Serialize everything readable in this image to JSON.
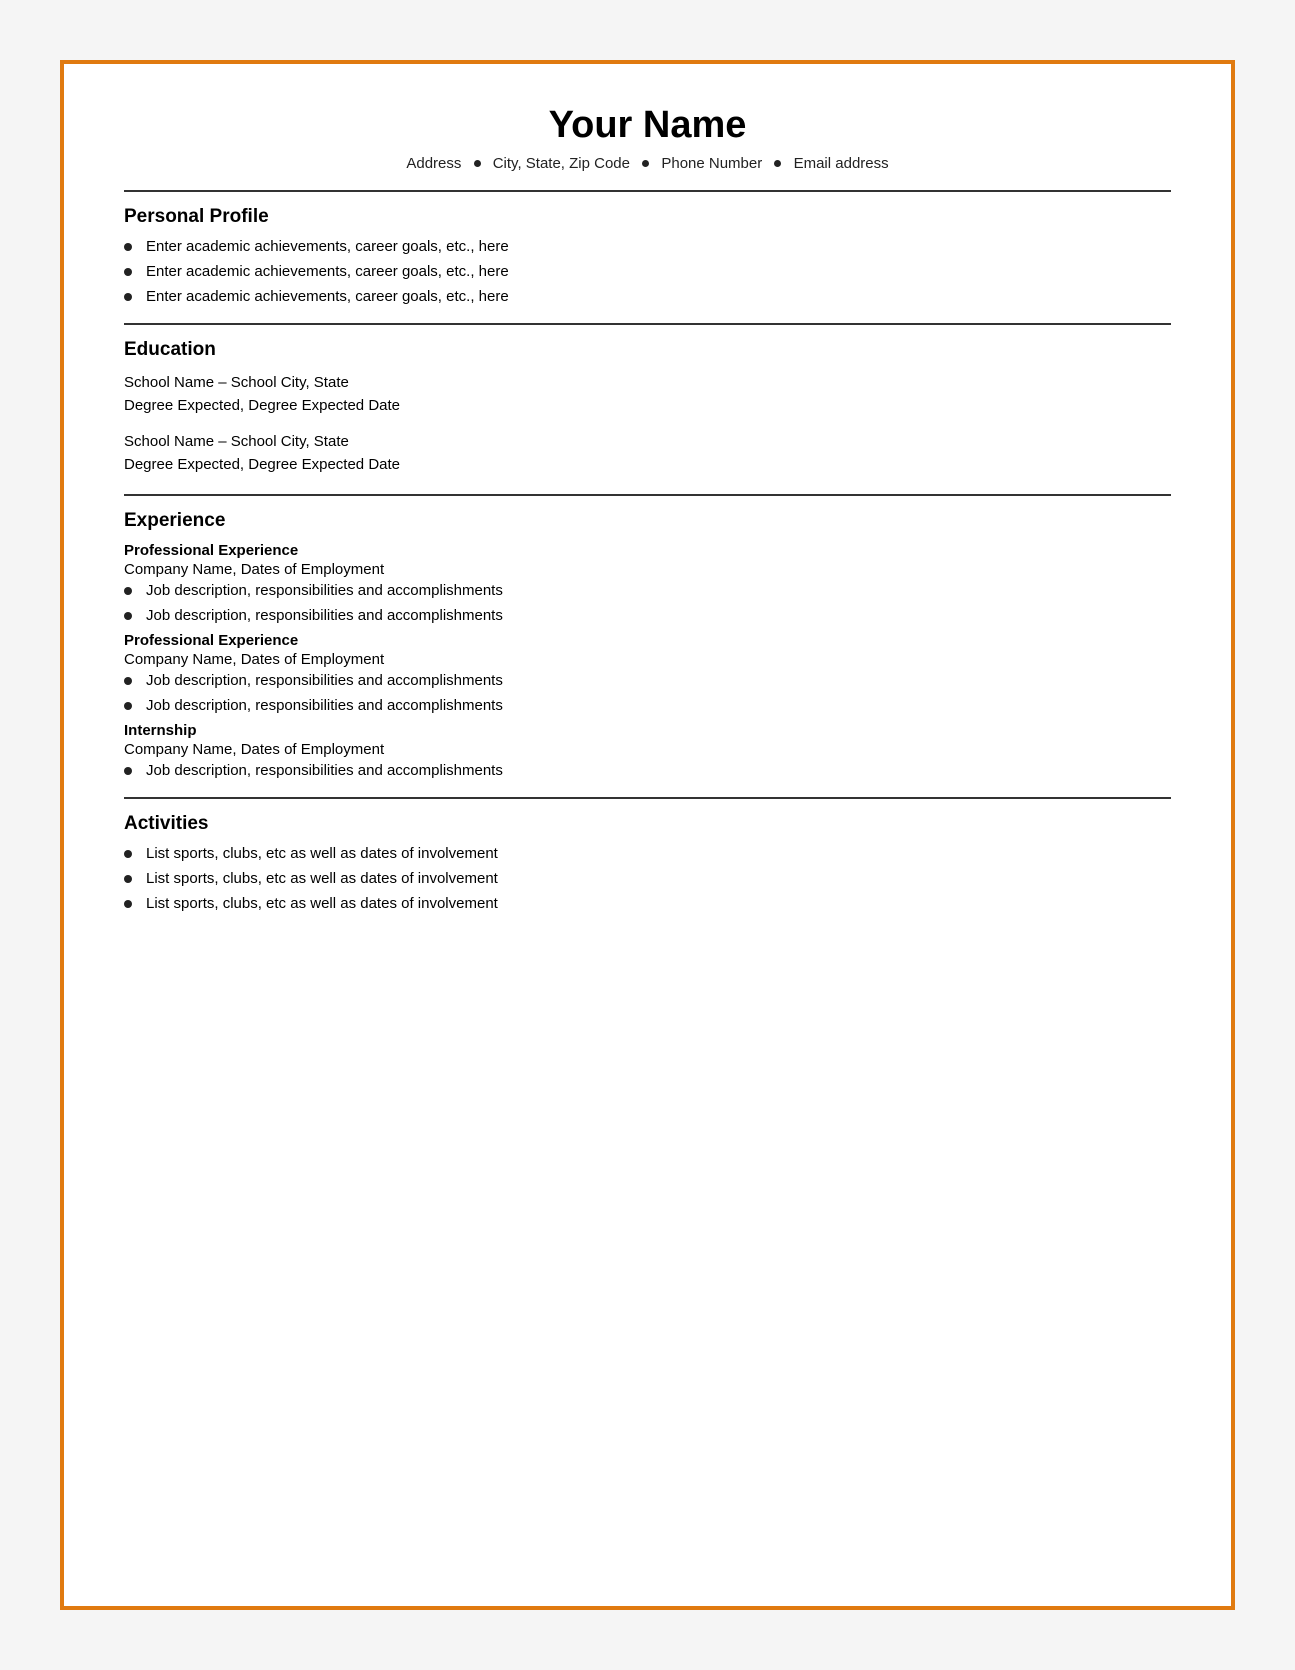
{
  "header": {
    "name": "Your Name",
    "contact": {
      "address": "Address",
      "city": "City, State, Zip Code",
      "phone": "Phone Number",
      "email": "Email address"
    }
  },
  "sections": {
    "personal_profile": {
      "title": "Personal Profile",
      "items": [
        "Enter academic achievements, career goals, etc., here",
        "Enter academic achievements, career goals, etc., here",
        "Enter academic achievements, career goals, etc., here"
      ]
    },
    "education": {
      "title": "Education",
      "entries": [
        {
          "school": "School Name – School City, State",
          "degree": "Degree Expected, Degree Expected Date"
        },
        {
          "school": "School Name – School City, State",
          "degree": "Degree Expected, Degree Expected Date"
        }
      ]
    },
    "experience": {
      "title": "Experience",
      "subsections": [
        {
          "subtitle": "Professional Experience",
          "company": "Company Name, Dates of Employment",
          "items": [
            "Job description, responsibilities and accomplishments",
            "Job description, responsibilities and accomplishments"
          ]
        },
        {
          "subtitle": "Professional Experience",
          "company": "Company Name, Dates of Employment",
          "items": [
            "Job description, responsibilities and accomplishments",
            "Job description, responsibilities and accomplishments"
          ]
        },
        {
          "subtitle": "Internship",
          "company": "Company Name, Dates of Employment",
          "items": [
            "Job description, responsibilities and accomplishments"
          ]
        }
      ]
    },
    "activities": {
      "title": "Activities",
      "items": [
        "List sports, clubs, etc as well as dates of involvement",
        "List sports, clubs, etc as well as dates of involvement",
        "List sports, clubs, etc as well as dates of involvement"
      ]
    }
  }
}
